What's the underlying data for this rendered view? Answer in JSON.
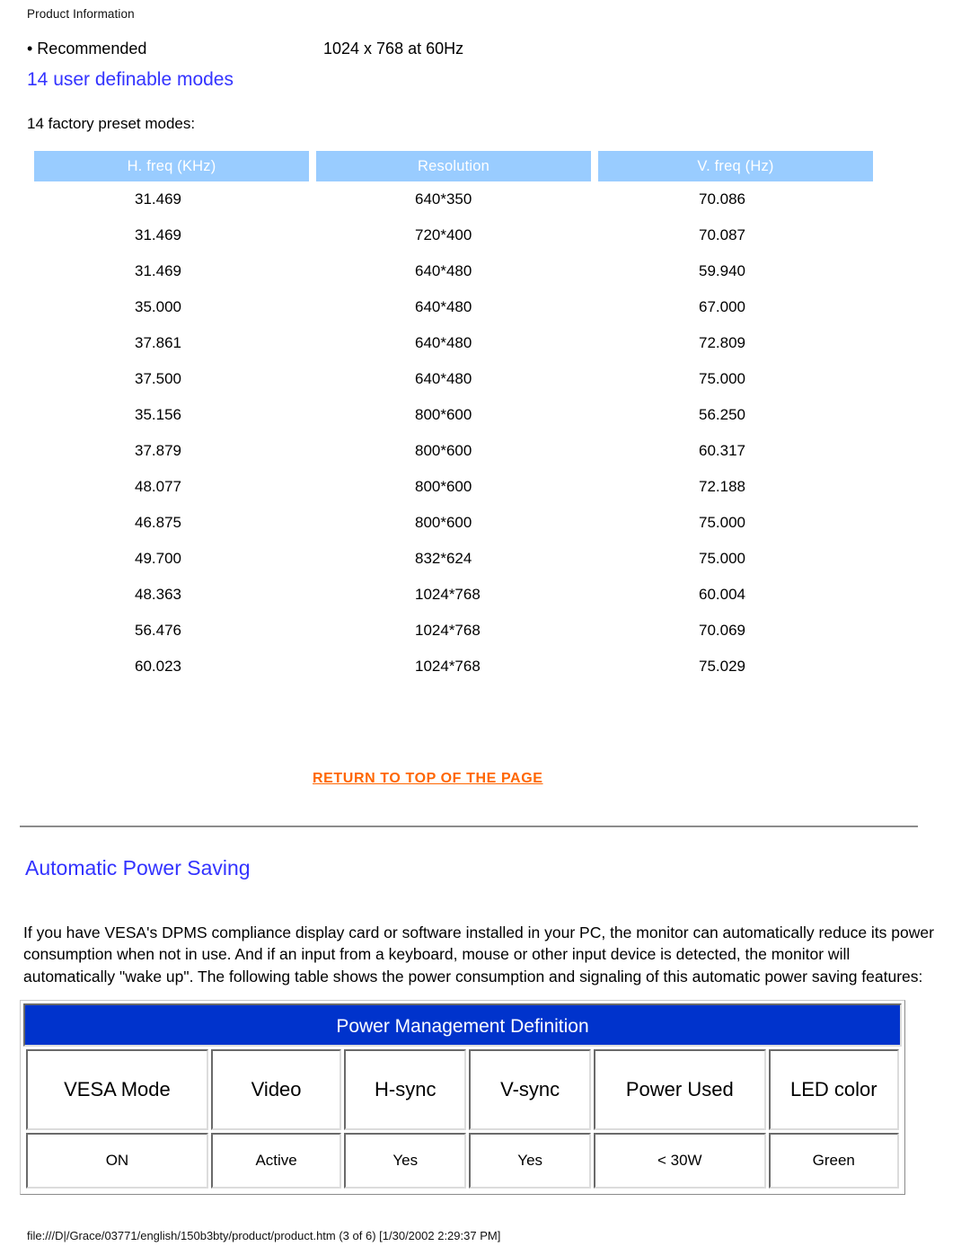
{
  "document": {
    "running_head": "Product Information",
    "footer": "file:///D|/Grace/03771/english/150b3bty/product/product.htm (3 of 6) [1/30/2002 2:29:37 PM]"
  },
  "colors": {
    "heading_blue": "#3333ff",
    "table_header_blue": "#99ccff",
    "link_orange": "#ff6600",
    "pm_title_blue": "#0033cc"
  },
  "recommended": {
    "label": "• Recommended",
    "value": "1024 x 768 at 60Hz"
  },
  "user_definable_heading": "14 user definable modes",
  "factory_preset_label": "14 factory preset modes:",
  "modes_table": {
    "headers": [
      "H. freq (KHz)",
      "Resolution",
      "V. freq (Hz)"
    ],
    "rows": [
      [
        "31.469",
        "640*350",
        "70.086"
      ],
      [
        "31.469",
        "720*400",
        "70.087"
      ],
      [
        "31.469",
        "640*480",
        "59.940"
      ],
      [
        "35.000",
        "640*480",
        "67.000"
      ],
      [
        "37.861",
        "640*480",
        "72.809"
      ],
      [
        "37.500",
        "640*480",
        "75.000"
      ],
      [
        "35.156",
        "800*600",
        "56.250"
      ],
      [
        "37.879",
        "800*600",
        "60.317"
      ],
      [
        "48.077",
        "800*600",
        "72.188"
      ],
      [
        "46.875",
        "800*600",
        "75.000"
      ],
      [
        "49.700",
        "832*624",
        "75.000"
      ],
      [
        "48.363",
        "1024*768",
        "60.004"
      ],
      [
        "56.476",
        "1024*768",
        "70.069"
      ],
      [
        "60.023",
        "1024*768",
        "75.029"
      ]
    ]
  },
  "return_link": "RETURN TO TOP OF THE PAGE",
  "power_saving": {
    "heading": "Automatic Power Saving",
    "paragraph": "If you have VESA's DPMS compliance display card or software installed in your PC, the monitor can automatically reduce its power consumption when not in use. And if an input from a keyboard, mouse or other input device is detected, the monitor will automatically \"wake up\". The following table shows the power consumption and signaling of this automatic power saving features:"
  },
  "pm_table": {
    "title": "Power Management Definition",
    "headers": [
      "VESA Mode",
      "Video",
      "H-sync",
      "V-sync",
      "Power Used",
      "LED color"
    ],
    "rows": [
      [
        "ON",
        "Active",
        "Yes",
        "Yes",
        "< 30W",
        "Green"
      ]
    ]
  }
}
